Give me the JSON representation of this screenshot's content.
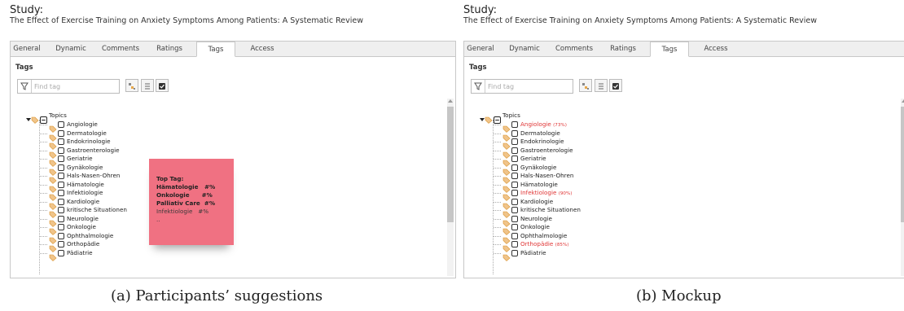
{
  "study_label": "Study:",
  "study_title": "The Effect of Exercise Training on Anxiety Symptoms Among Patients: A Systematic Review",
  "tabs": [
    "General",
    "Dynamic",
    "Comments",
    "Ratings",
    "Tags",
    "Access"
  ],
  "active_tab": "Tags",
  "section_title": "Tags",
  "search_placeholder": "Find tag",
  "root_label": "Topics",
  "tags": [
    "Angiologie",
    "Dermatologie",
    "Endokrinologie",
    "Gastroenterologie",
    "Geriatrie",
    "Gynäkologie",
    "Hals-Nasen-Ohren",
    "Hämatologie",
    "Infektiologie",
    "Kardiologie",
    "kritische Situationen",
    "Neurologie",
    "Onkologie",
    "Ophthalmologie",
    "Orthopädie",
    "Pädiatrie"
  ],
  "panel_b_highlights": {
    "Angiologie": "(73%)",
    "Infektiologie": "(90%)",
    "Orthopädie": "(85%)"
  },
  "sticky_note": {
    "heading": "Top Tag:",
    "lines": [
      "Hämatologie   #%",
      "Onkologie      #%",
      "Palliativ Care  #%"
    ],
    "faint_line": "Infektiologie   #%",
    "ellipsis": ".."
  },
  "captions": [
    "(a) Participants’ suggestions",
    "(b) Mockup"
  ],
  "colors": {
    "highlight_red": "#e03535",
    "sticky_note": "#f07182",
    "tag_icon_orange": "#e8a84a"
  },
  "icons": {
    "filter": "funnel-icon",
    "tool_1": "tag-tree-icon",
    "tool_2": "list-icon",
    "tool_3": "checkbox-checked-icon",
    "expand": "triangle-down-icon",
    "collapse": "minus-square-icon",
    "tag": "tag-icon"
  }
}
